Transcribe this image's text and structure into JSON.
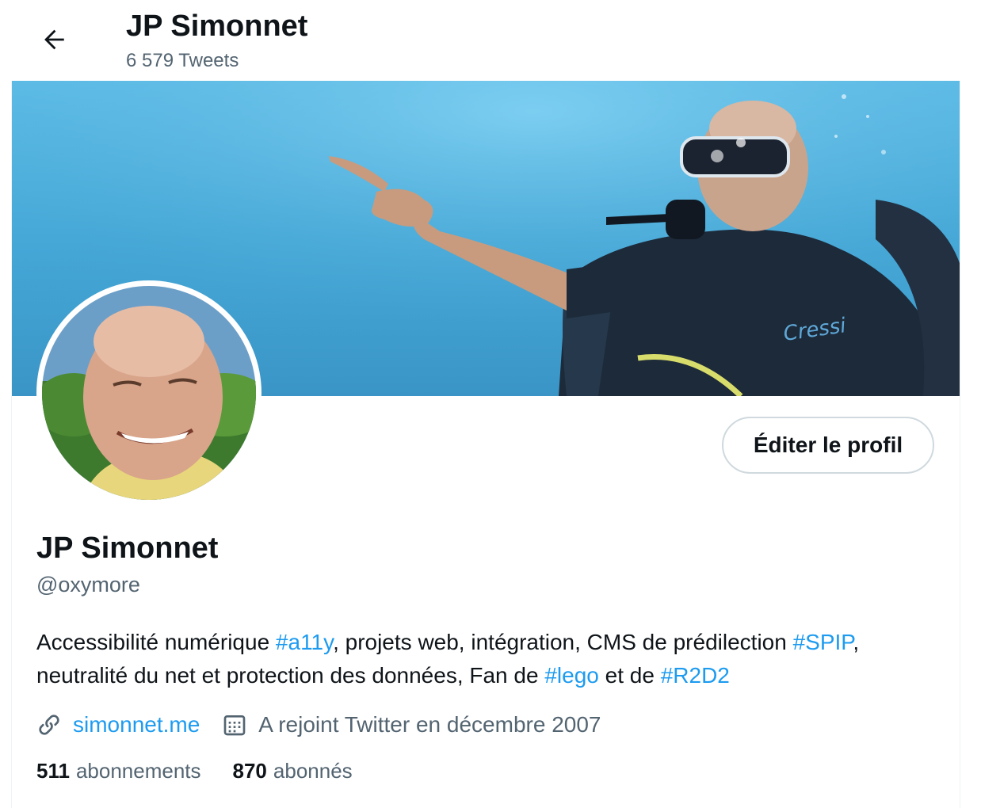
{
  "header": {
    "back_icon": "arrow-left-icon",
    "title": "JP Simonnet",
    "tweet_count": "6 579 Tweets"
  },
  "banner": {
    "description_icon": "banner-photo"
  },
  "profile": {
    "name": "JP Simonnet",
    "handle": "@oxymore",
    "edit_button": "Éditer le profil",
    "bio": {
      "line1_a": "Accessibilité numérique ",
      "tag1": "#a11y",
      "line1_b": ", projets web, intégration, CMS de prédilection ",
      "tag2": "#SPIP",
      "line1_c": ",",
      "line2_a": "neutralité du net et protection des données, Fan de ",
      "tag3": "#lego",
      "line2_b": " et de ",
      "tag4": "#R2D2"
    },
    "website": "simonnet.me",
    "website_icon": "link-icon",
    "joined": "A rejoint Twitter en décembre 2007",
    "joined_icon": "calendar-icon",
    "following_count": "511",
    "following_label": "abonnements",
    "followers_count": "870",
    "followers_label": "abonnés"
  },
  "colors": {
    "accent": "#1d9bf0",
    "text_primary": "#0f1419",
    "text_secondary": "#536471",
    "border": "#cfd9de"
  }
}
